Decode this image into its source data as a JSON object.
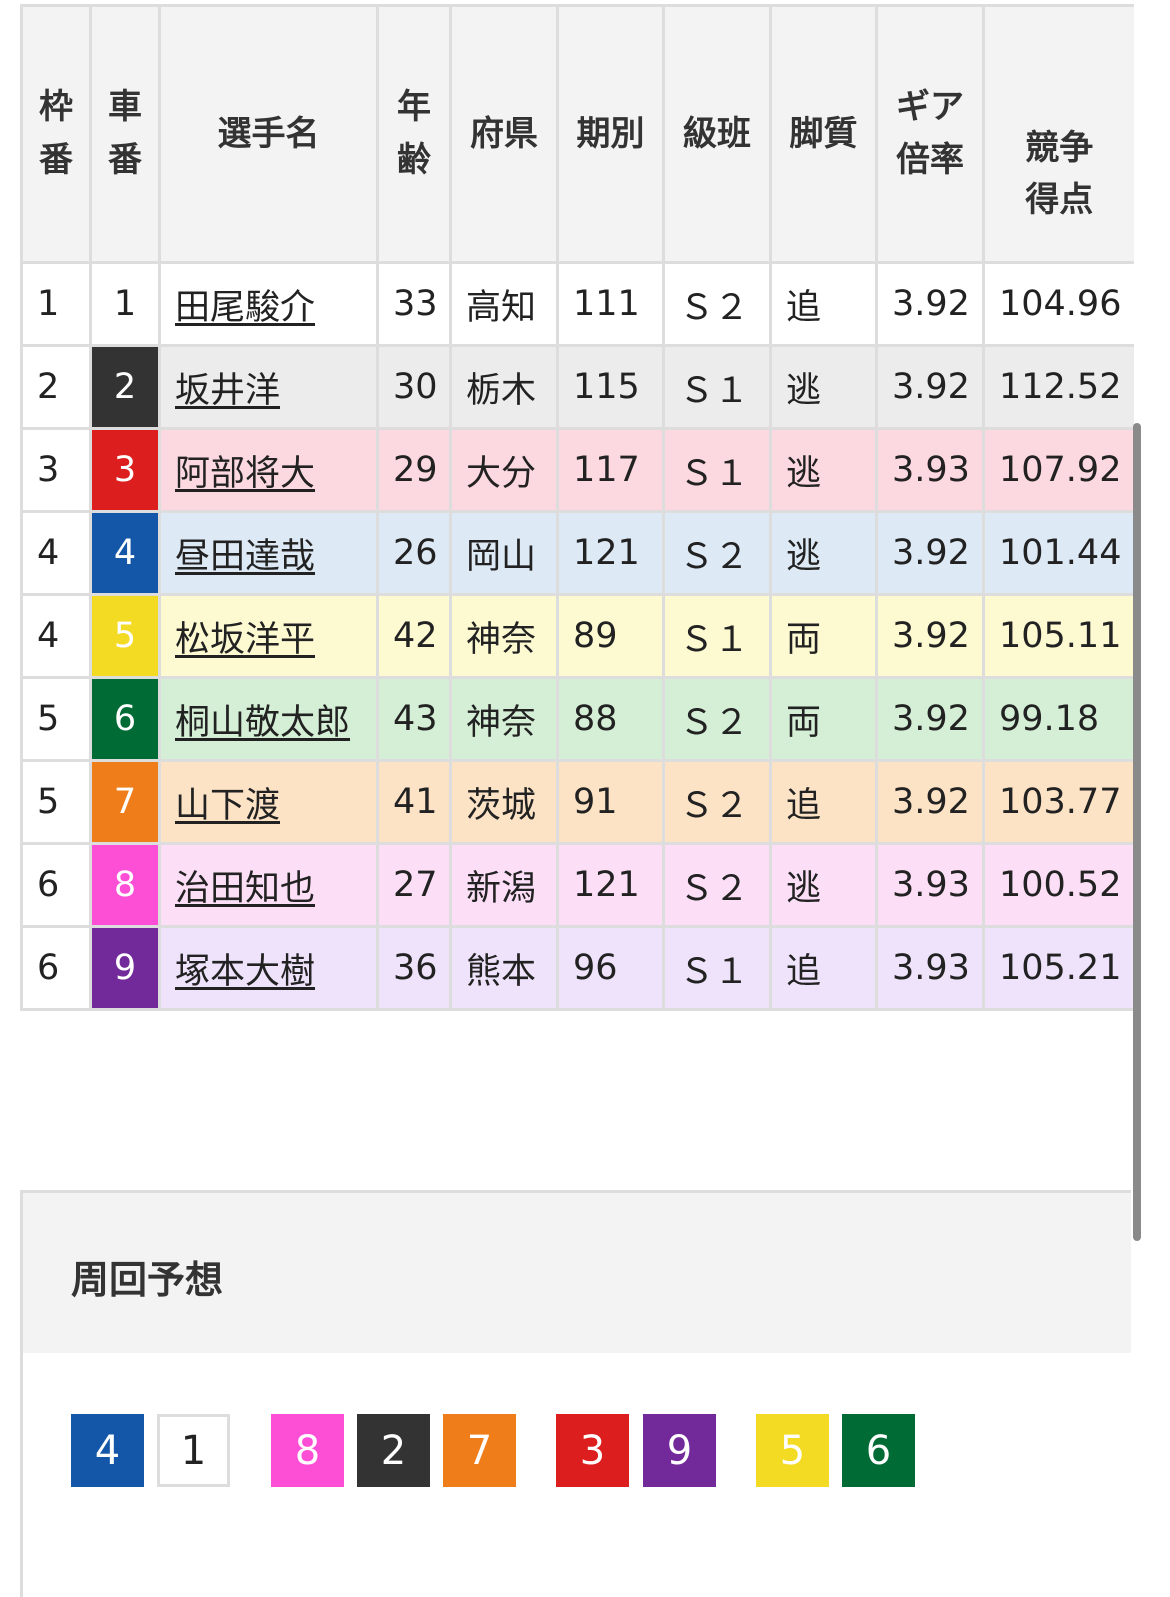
{
  "table": {
    "headers": {
      "frame": "枠番",
      "car": "車番",
      "name": "選手名",
      "age": "年齢",
      "pref": "府県",
      "term": "期別",
      "class": "級班",
      "style": "脚質",
      "gear": "ギア倍率",
      "score": "競争得点"
    },
    "rows": [
      {
        "frame": "1",
        "car": "1",
        "name": "田尾駿介",
        "age": "33",
        "pref": "高知",
        "term": "111",
        "class": "Ｓ２",
        "style": "追",
        "gear": "3.92",
        "score": "104.96"
      },
      {
        "frame": "2",
        "car": "2",
        "name": "坂井洋",
        "age": "30",
        "pref": "栃木",
        "term": "115",
        "class": "Ｓ１",
        "style": "逃",
        "gear": "3.92",
        "score": "112.52"
      },
      {
        "frame": "3",
        "car": "3",
        "name": "阿部将大",
        "age": "29",
        "pref": "大分",
        "term": "117",
        "class": "Ｓ１",
        "style": "逃",
        "gear": "3.93",
        "score": "107.92"
      },
      {
        "frame": "4",
        "car": "4",
        "name": "昼田達哉",
        "age": "26",
        "pref": "岡山",
        "term": "121",
        "class": "Ｓ２",
        "style": "逃",
        "gear": "3.92",
        "score": "101.44"
      },
      {
        "frame": "4",
        "car": "5",
        "name": "松坂洋平",
        "age": "42",
        "pref": "神奈",
        "term": "89",
        "class": "Ｓ１",
        "style": "両",
        "gear": "3.92",
        "score": "105.11"
      },
      {
        "frame": "5",
        "car": "6",
        "name": "桐山敬太郎",
        "age": "43",
        "pref": "神奈",
        "term": "88",
        "class": "Ｓ２",
        "style": "両",
        "gear": "3.92",
        "score": "99.18"
      },
      {
        "frame": "5",
        "car": "7",
        "name": "山下渡",
        "age": "41",
        "pref": "茨城",
        "term": "91",
        "class": "Ｓ２",
        "style": "追",
        "gear": "3.92",
        "score": "103.77"
      },
      {
        "frame": "6",
        "car": "8",
        "name": "治田知也",
        "age": "27",
        "pref": "新潟",
        "term": "121",
        "class": "Ｓ２",
        "style": "逃",
        "gear": "3.93",
        "score": "100.52"
      },
      {
        "frame": "6",
        "car": "9",
        "name": "塚本大樹",
        "age": "36",
        "pref": "熊本",
        "term": "96",
        "class": "Ｓ１",
        "style": "追",
        "gear": "3.93",
        "score": "105.21"
      }
    ]
  },
  "car_colors": {
    "1": "#ffffff",
    "2": "#333333",
    "3": "#dc1e1e",
    "4": "#1457a8",
    "5": "#f3da23",
    "6": "#006b34",
    "7": "#ee7d1a",
    "8": "#fd4fd6",
    "9": "#722a9a"
  },
  "forecast": {
    "title": "周回予想",
    "cars": [
      "4",
      "1",
      "8",
      "2",
      "7",
      "3",
      "9",
      "5",
      "6"
    ]
  }
}
